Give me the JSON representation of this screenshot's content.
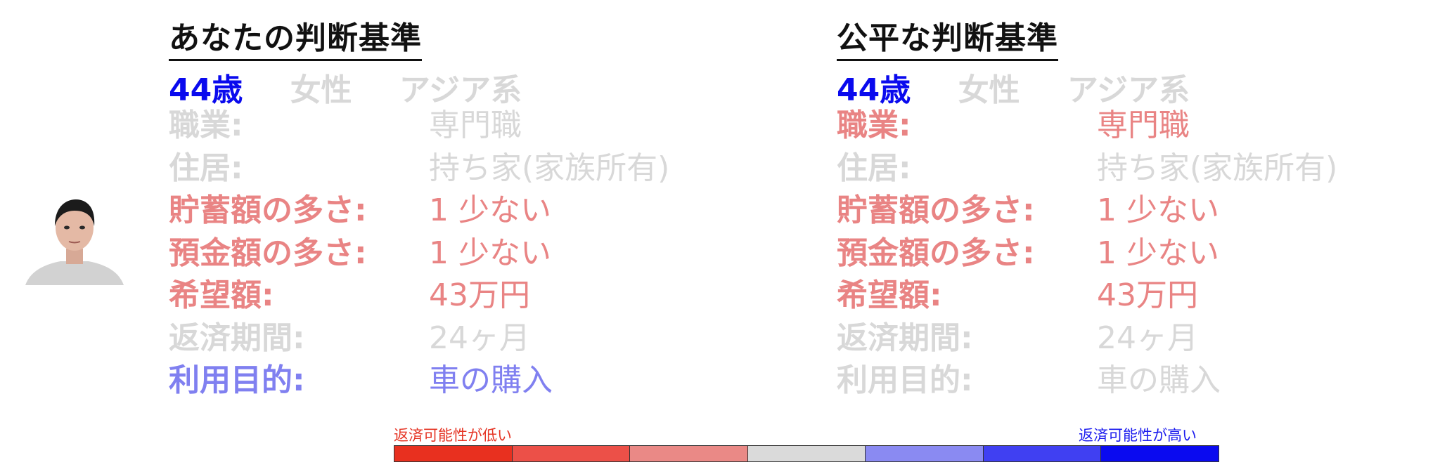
{
  "colors": {
    "high_positive": "#0a0aee",
    "mid_positive": "#8080f0",
    "mid_negative": "#e98484",
    "neutral": "#d8d8d8",
    "title": "#111111"
  },
  "left": {
    "title": "あなたの判断基準",
    "demo": [
      {
        "text": "44歳",
        "color": "#0a0aee"
      },
      {
        "text": "女性",
        "color": "#d8d8d8"
      },
      {
        "text": "アジア系",
        "color": "#d8d8d8"
      }
    ],
    "rows": [
      {
        "label": "職業:",
        "value": "専門職",
        "color": "#d8d8d8"
      },
      {
        "label": "住居:",
        "value": "持ち家(家族所有)",
        "color": "#d8d8d8"
      },
      {
        "label": "貯蓄額の多さ:",
        "value": "1 少ない",
        "color": "#e98484"
      },
      {
        "label": "預金額の多さ:",
        "value": "1 少ない",
        "color": "#e98484"
      },
      {
        "label": "希望額:",
        "value": "43万円",
        "color": "#e98484"
      },
      {
        "label": "返済期間:",
        "value": "24ヶ月",
        "color": "#d8d8d8"
      },
      {
        "label": "利用目的:",
        "value": "車の購入",
        "color": "#8080f0"
      }
    ]
  },
  "right": {
    "title": "公平な判断基準",
    "demo": [
      {
        "text": "44歳",
        "color": "#0a0aee"
      },
      {
        "text": "女性",
        "color": "#d8d8d8"
      },
      {
        "text": "アジア系",
        "color": "#d8d8d8"
      }
    ],
    "rows": [
      {
        "label": "職業:",
        "value": "専門職",
        "color": "#e98484"
      },
      {
        "label": "住居:",
        "value": "持ち家(家族所有)",
        "color": "#d8d8d8"
      },
      {
        "label": "貯蓄額の多さ:",
        "value": "1 少ない",
        "color": "#e98484"
      },
      {
        "label": "預金額の多さ:",
        "value": "1 少ない",
        "color": "#e98484"
      },
      {
        "label": "希望額:",
        "value": "43万円",
        "color": "#e98484"
      },
      {
        "label": "返済期間:",
        "value": "24ヶ月",
        "color": "#d8d8d8"
      },
      {
        "label": "利用目的:",
        "value": "車の購入",
        "color": "#d8d8d8"
      }
    ]
  },
  "legend": {
    "low_label": "返済可能性が低い",
    "high_label": "返済可能性が高い",
    "scale": [
      "#e8301f",
      "#ec5048",
      "#ea8986",
      "#dadada",
      "#8a8af2",
      "#4040f2",
      "#0a0af0"
    ]
  },
  "avatar": {
    "icon": "person-photo-icon"
  }
}
